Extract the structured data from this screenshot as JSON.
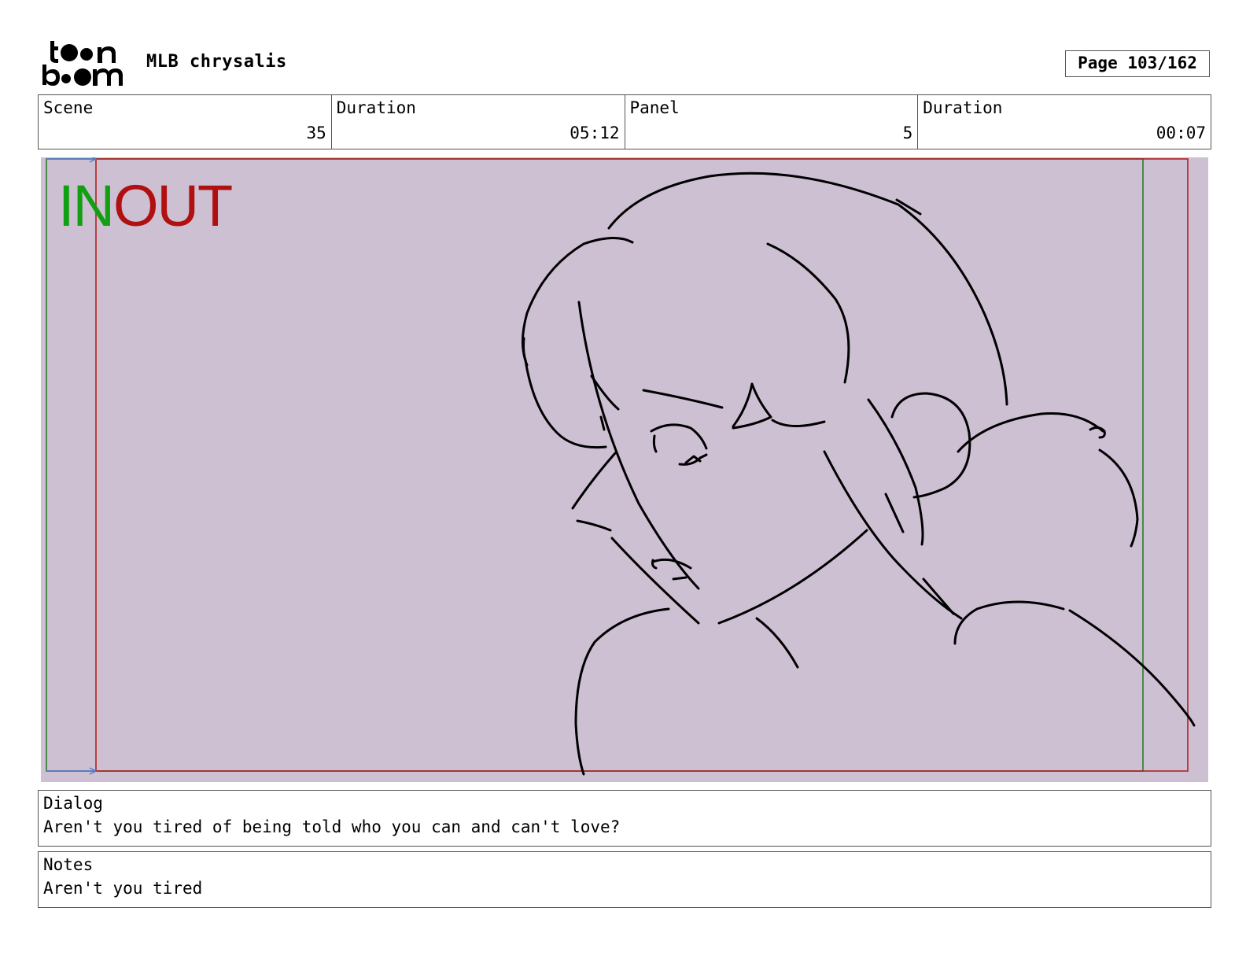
{
  "header": {
    "logo_top": "toon",
    "logo_bottom": "boom",
    "project_title": "MLB chrysalis",
    "page_label": "Page 103/162"
  },
  "info": {
    "scene_label": "Scene",
    "scene_value": "35",
    "scene_duration_label": "Duration",
    "scene_duration_value": "05:12",
    "panel_label": "Panel",
    "panel_value": "5",
    "panel_duration_label": "Duration",
    "panel_duration_value": "00:07"
  },
  "frame": {
    "in_label": "IN",
    "out_label": "OUT",
    "background_color": "#cdc0d3",
    "in_color": "#12a012",
    "out_color": "#b01010"
  },
  "dialog": {
    "label": "Dialog",
    "text": "Aren't you tired of being told who you can and can't love?"
  },
  "notes": {
    "label": "Notes",
    "text": "Aren't you tired"
  }
}
